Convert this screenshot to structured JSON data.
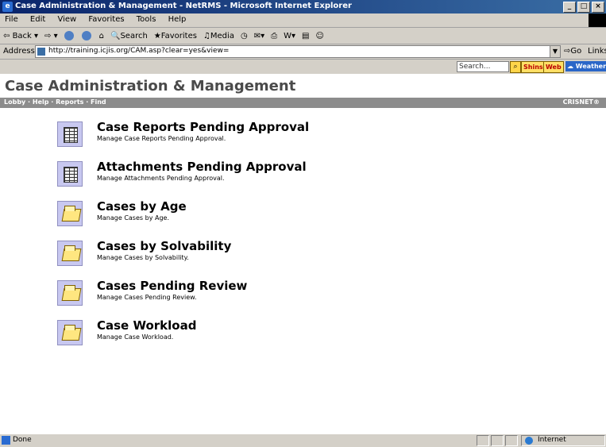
{
  "window": {
    "title": "Case Administration & Management - NetRMS - Microsoft Internet Explorer"
  },
  "menu": [
    "File",
    "Edit",
    "View",
    "Favorites",
    "Tools",
    "Help"
  ],
  "toolbar": {
    "back": "Back",
    "search": "Search",
    "favorites": "Favorites",
    "media": "Media"
  },
  "address": {
    "label": "Address",
    "url": "http://training.icjis.org/CAM.asp?clear=yes&view=",
    "go": "Go",
    "links": "Links"
  },
  "searchbar": {
    "placeholder": "Search...",
    "shins": "Shins",
    "web": "Web",
    "weather": "Weather"
  },
  "page": {
    "title": "Case Administration & Management",
    "nav": "Lobby · Help · Reports · Find",
    "brand": "CRISNET®",
    "items": [
      {
        "name": "Case Reports Pending Approval",
        "desc": "Manage Case Reports Pending Approval.",
        "icon": "grid-report-icon"
      },
      {
        "name": "Attachments Pending Approval",
        "desc": "Manage Attachments Pending Approval.",
        "icon": "grid-report-icon"
      },
      {
        "name": "Cases by Age",
        "desc": "Manage Cases by Age.",
        "icon": "folder-icon"
      },
      {
        "name": "Cases by Solvability",
        "desc": "Manage Cases by Solvability.",
        "icon": "folder-icon"
      },
      {
        "name": "Cases Pending Review",
        "desc": "Manage Cases Pending Review.",
        "icon": "folder-icon"
      },
      {
        "name": "Case Workload",
        "desc": "Manage Case Workload.",
        "icon": "folder-icon"
      }
    ]
  },
  "status": {
    "text": "Done",
    "zone": "Internet"
  }
}
